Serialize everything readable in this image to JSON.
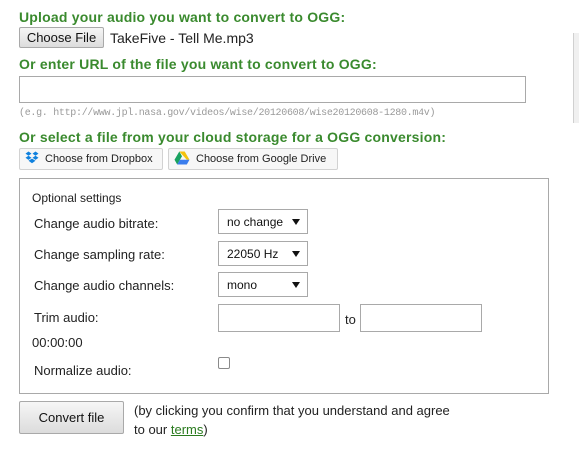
{
  "upload": {
    "heading": "Upload your audio you want to convert to OGG:",
    "choose_file_label": "Choose File",
    "file_name": "TakeFive - Tell Me.mp3"
  },
  "url": {
    "heading": "Or enter URL of the file you want to convert to OGG:",
    "value": "",
    "example": "(e.g. http://www.jpl.nasa.gov/videos/wise/20120608/wise20120608-1280.m4v)"
  },
  "cloud": {
    "heading": "Or select a file from your cloud storage for a OGG conversion:",
    "dropbox_label": "Choose from Dropbox",
    "gdrive_label": "Choose from Google Drive"
  },
  "settings": {
    "legend": "Optional settings",
    "bitrate_label": "Change audio bitrate:",
    "bitrate_value": "no change",
    "sampling_label": "Change sampling rate:",
    "sampling_value": "22050 Hz",
    "channels_label": "Change audio channels:",
    "channels_value": "mono",
    "trim_label": "Trim audio:",
    "trim_to": "to",
    "trim_start": "",
    "trim_end": "",
    "trim_time": "00:00:00",
    "normalize_label": "Normalize audio:",
    "normalize_checked": false
  },
  "convert": {
    "button_label": "Convert file",
    "note_line1": "(by clicking you confirm that you understand and agree",
    "note_prefix": "to our",
    "terms_link": "terms",
    "note_suffix": ")"
  },
  "colors": {
    "heading_green": "#3a8a2e",
    "link_green": "#2a7a1e"
  }
}
